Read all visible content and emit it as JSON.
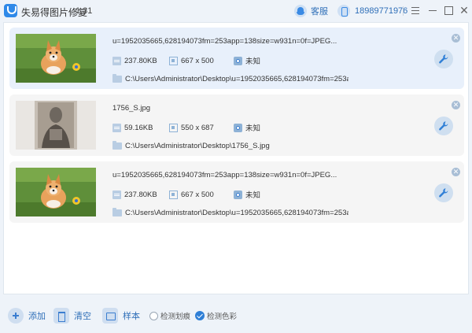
{
  "app": {
    "title": "失易得图片修复",
    "version": "1.31"
  },
  "header": {
    "support_label": "客服",
    "phone": "18989771976",
    "close_glyph": "✕"
  },
  "files": [
    {
      "name": "u=1952035665,628194073fm=253app=138size=w931n=0f=JPEG...",
      "size": "237.80KB",
      "dimensions": "667 x 500",
      "status": "未知",
      "path": "C:\\Users\\Administrator\\Desktop\\u=1952035665,628194073fm=253ap...",
      "selected": true,
      "thumb": "dog"
    },
    {
      "name": "1756_S.jpg",
      "size": "59.16KB",
      "dimensions": "550 x 687",
      "status": "未知",
      "path": "C:\\Users\\Administrator\\Desktop\\1756_S.jpg",
      "selected": false,
      "thumb": "portrait"
    },
    {
      "name": "u=1952035665,628194073fm=253app=138size=w931n=0f=JPEG...",
      "size": "237.80KB",
      "dimensions": "667 x 500",
      "status": "未知",
      "path": "C:\\Users\\Administrator\\Desktop\\u=1952035665,628194073fm=253ap...",
      "selected": false,
      "thumb": "dog"
    }
  ],
  "card_close_glyph": "✕",
  "toolbar": {
    "add_label": "添加",
    "clear_label": "清空",
    "sample_label": "样本",
    "detect_scratch_label": "检测划痕",
    "detect_scratch_checked": false,
    "detect_color_label": "检测色彩",
    "detect_color_checked": true
  },
  "colors": {
    "accent": "#2f7fd6",
    "selected_card": "#e8f0fb",
    "card": "#f5f5f5"
  }
}
